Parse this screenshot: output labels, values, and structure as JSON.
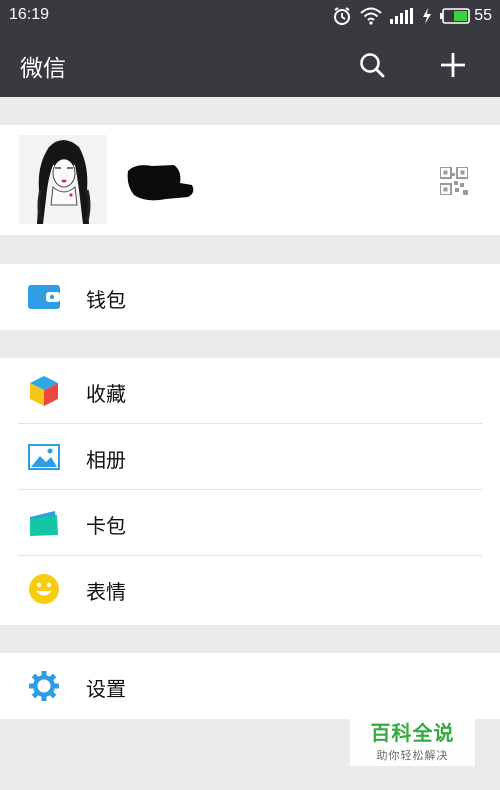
{
  "status_bar": {
    "time": "16:19",
    "battery_level": "55",
    "icons": [
      "alarm-icon",
      "wifi-icon",
      "signal-icon",
      "charging-icon",
      "battery-icon"
    ]
  },
  "header": {
    "title": "微信",
    "actions": [
      "search-icon",
      "plus-icon"
    ]
  },
  "profile": {
    "avatar": "avatar-illustration",
    "nickname": "",
    "qr_code": "qr-code-icon"
  },
  "menu": {
    "wallet": "钱包",
    "favorites": "收藏",
    "album": "相册",
    "cards": "卡包",
    "stickers": "表情",
    "settings": "设置"
  },
  "watermark": {
    "title": "百科全说",
    "subtitle": "助你轻松解决"
  },
  "colors": {
    "bar": "#393a3f",
    "background": "#ebebeb",
    "icon_blue": "#2d9ee3",
    "green": "#2fa83a"
  }
}
